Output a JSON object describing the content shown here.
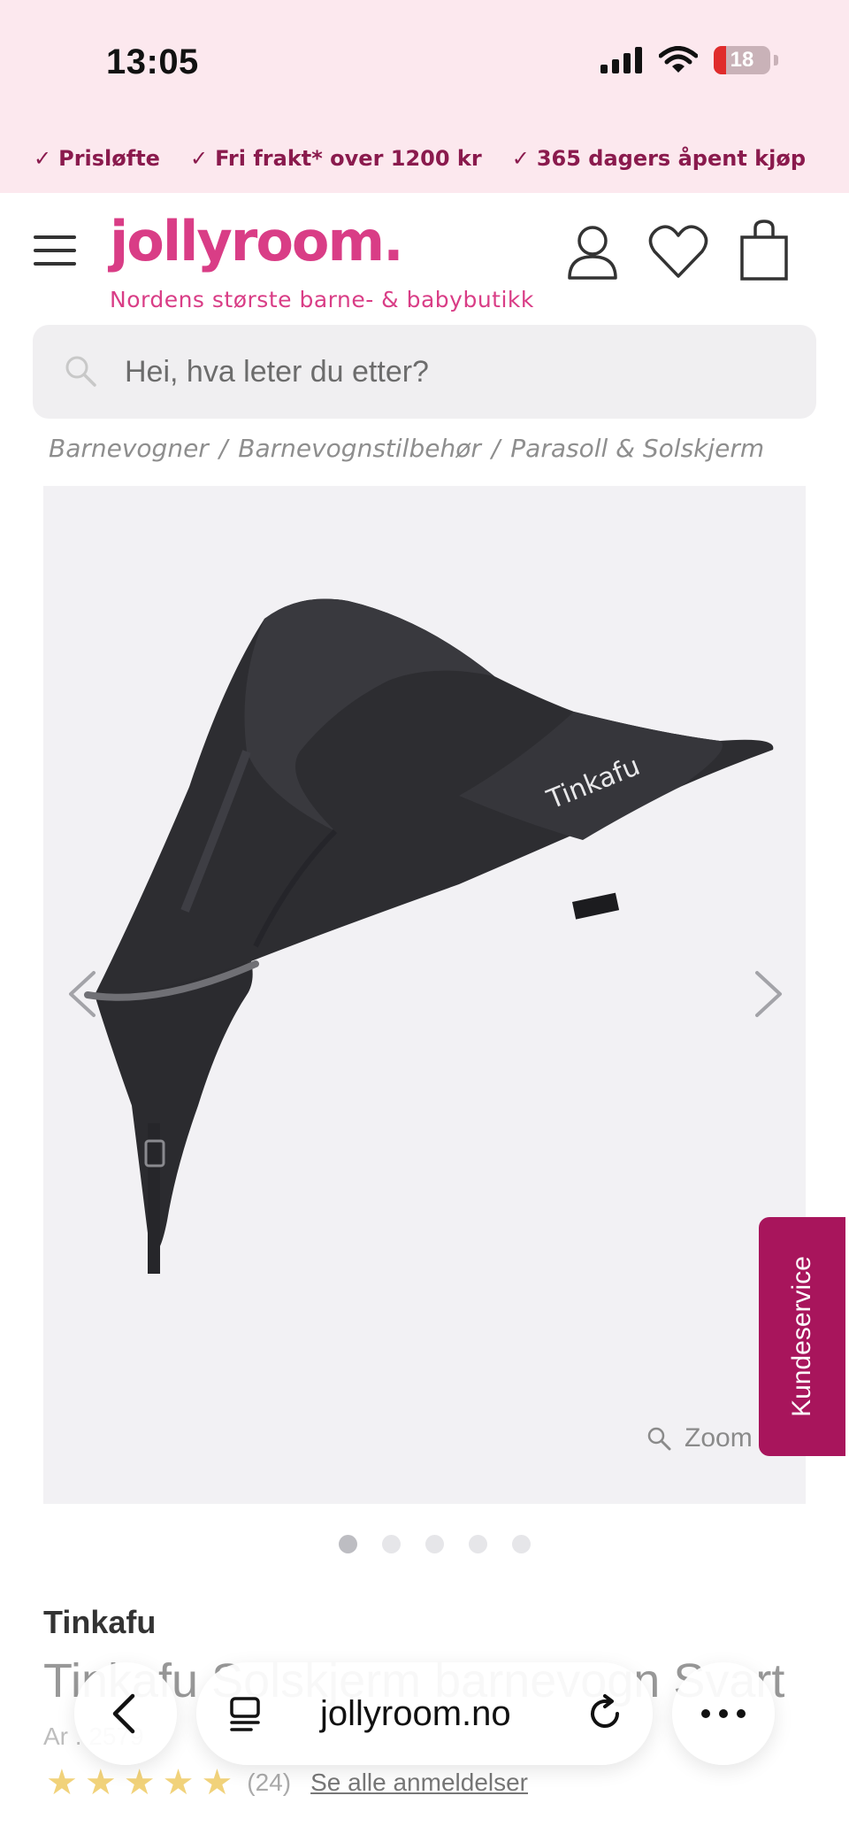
{
  "status_bar": {
    "time": "13:05",
    "battery": "18"
  },
  "usp": [
    {
      "label": "Prisløfte"
    },
    {
      "label": "Fri frakt* over 1200 kr"
    },
    {
      "label": "365 dagers åpent kjøp"
    }
  ],
  "header": {
    "logo": "jollyroom.",
    "tagline": "Nordens største barne- & babybutikk"
  },
  "search": {
    "placeholder": "Hei, hva leter du etter?"
  },
  "breadcrumb": [
    {
      "label": "Barnevogner"
    },
    {
      "label": "Barnevognstilbehør"
    },
    {
      "label": "Parasoll & Solskjerm"
    }
  ],
  "breadcrumb_sep": "/",
  "gallery": {
    "zoom_label": "Zoom",
    "image_brand_text": "Tinkafu",
    "slides_total": 5,
    "active_slide": 1
  },
  "kundeservice": "Kundeservice",
  "product": {
    "brand": "Tinkafu",
    "title_partial": "Tinkafu Solskjerm barnevogn Svart",
    "artnr_partial": "Ar  . 2579",
    "rating": 5,
    "review_count": "(24)",
    "reviews_link": "Se alle anmeldelser"
  },
  "browser": {
    "url": "jollyroom.no"
  },
  "colors": {
    "brand_pink": "#d93d86",
    "usp_text": "#8a1a4d",
    "kundeservice_bg": "#a8155c",
    "top_bg": "#fce8ee"
  }
}
